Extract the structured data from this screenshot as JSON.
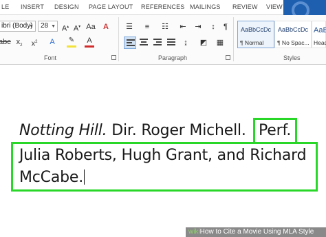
{
  "ribbon_tabs": [
    "LE",
    "INSERT",
    "DESIGN",
    "PAGE LAYOUT",
    "REFERENCES",
    "MAILINGS",
    "REVIEW",
    "VIEW"
  ],
  "font": {
    "family_value": "ibri (Body)",
    "size_value": "28",
    "group_label": "Font"
  },
  "paragraph": {
    "group_label": "Paragraph"
  },
  "styles": {
    "group_label": "Styles",
    "cards": [
      {
        "sample": "AaBbCcDc",
        "name": "¶ Normal"
      },
      {
        "sample": "AaBbCcDc",
        "name": "¶ No Spac..."
      },
      {
        "sample": "AaBl",
        "name": "Head"
      }
    ]
  },
  "document": {
    "line1_title": "Notting Hill.",
    "line1_rest": " Dir. Roger Michell.",
    "line1_highlight": "Perf.",
    "line2": "Julia Roberts, Hugh Grant, and Richard",
    "line3": "McCabe."
  },
  "watermark": {
    "brand": "wiki",
    "text": "How to Cite a Movie Using MLA Style"
  },
  "colors": {
    "highlight_border": "#28d728",
    "font_color_underline": "#d12b2b",
    "text_highlight_color": "#f2e23a"
  }
}
